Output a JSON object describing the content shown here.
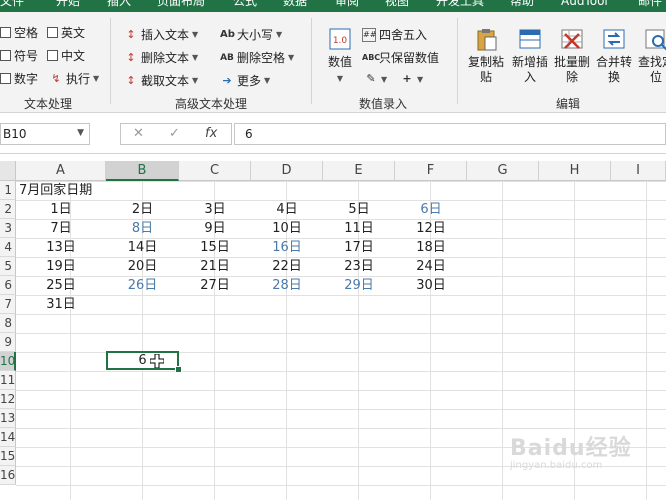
{
  "ribbon": {
    "tabs": [
      "文件",
      "开始",
      "插入",
      "页面布局",
      "公式",
      "数据",
      "审阅",
      "视图",
      "开发工具",
      "帮助",
      "AudTool",
      "邮件"
    ],
    "groups": {
      "text_process": {
        "label": "文本处理",
        "items": [
          "空格",
          "英文",
          "符号",
          "中文",
          "数字",
          "执行"
        ]
      },
      "advanced_text": {
        "label": "高级文本处理",
        "items": [
          "插入文本",
          "大小写",
          "删除文本",
          "删除空格",
          "截取文本",
          "更多"
        ]
      },
      "number_entry": {
        "label": "数值录入",
        "items": [
          "数值",
          "四舍五入",
          "只保留数值"
        ]
      },
      "edit": {
        "label": "编辑",
        "items": [
          "复制粘贴",
          "新增插入",
          "批量删除",
          "合并转换",
          "查找定位"
        ]
      }
    }
  },
  "formula_bar": {
    "name_box": "B10",
    "fx_label": "fx",
    "value": "6"
  },
  "sheet": {
    "columns": [
      "A",
      "B",
      "C",
      "D",
      "E",
      "F",
      "G",
      "H",
      "I"
    ],
    "selected_column": "B",
    "row_numbers": [
      "1",
      "2",
      "3",
      "4",
      "5",
      "6",
      "7",
      "8",
      "9",
      "10",
      "11",
      "12",
      "13",
      "14",
      "15",
      "16"
    ],
    "selected_row": "10",
    "title": "7月回家日期",
    "rows": [
      [
        "1日",
        "2日",
        "3日",
        "4日",
        "5日",
        "6日"
      ],
      [
        "7日",
        "8日",
        "9日",
        "10日",
        "11日",
        "12日"
      ],
      [
        "13日",
        "14日",
        "15日",
        "16日",
        "17日",
        "18日"
      ],
      [
        "19日",
        "20日",
        "21日",
        "22日",
        "23日",
        "24日"
      ],
      [
        "25日",
        "26日",
        "27日",
        "28日",
        "29日",
        "30日"
      ],
      [
        "31日"
      ]
    ],
    "highlighted_dates": [
      "6日",
      "8日",
      "16日",
      "26日",
      "28日",
      "29日"
    ],
    "highlight_color": "#4a7aa8",
    "active_cell_value": "6"
  },
  "watermark": {
    "text": "Baidu经验",
    "sub": "jingyan.baidu.com"
  },
  "colors": {
    "accent": "#217346"
  }
}
